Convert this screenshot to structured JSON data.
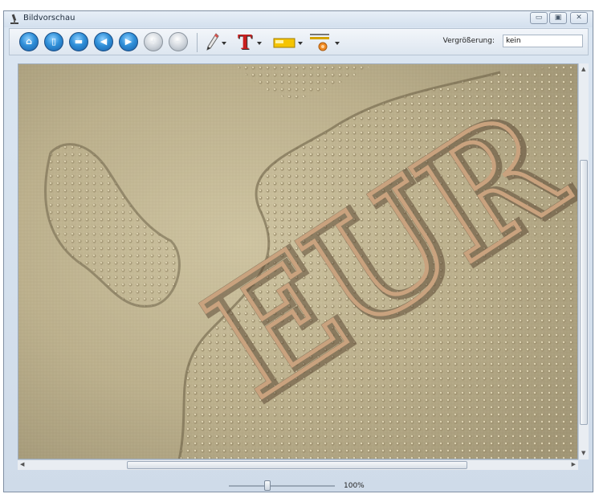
{
  "window": {
    "title": "Bildvorschau",
    "controls": {
      "minimize_glyph": "▭",
      "maximize_glyph": "▣",
      "close_glyph": "✕"
    }
  },
  "toolbar": {
    "buttons": [
      {
        "name": "home",
        "icon": "home-icon",
        "glyph": "⌂"
      },
      {
        "name": "new-document",
        "icon": "document-icon",
        "glyph": "▯"
      },
      {
        "name": "print",
        "icon": "printer-icon",
        "glyph": "▬"
      },
      {
        "name": "previous",
        "icon": "arrow-left-icon",
        "glyph": "◀"
      },
      {
        "name": "next",
        "icon": "arrow-right-icon",
        "glyph": "▶"
      },
      {
        "name": "zoom-in",
        "icon": "zoom-in-icon",
        "glyph": "+"
      },
      {
        "name": "zoom-out",
        "icon": "zoom-out-icon",
        "glyph": "−"
      }
    ],
    "tools": [
      {
        "name": "pencil",
        "icon": "pencil-icon"
      },
      {
        "name": "text",
        "icon": "text-tool-icon",
        "glyph": "T"
      },
      {
        "name": "highlight-color",
        "icon": "color-swatch-icon"
      },
      {
        "name": "line-width",
        "icon": "line-width-icon"
      }
    ],
    "zoom_label": "Vergrößerung:",
    "zoom_value": "kein"
  },
  "image": {
    "subject": "coin-closeup",
    "lettering": "EUR"
  },
  "status": {
    "zoom_percent": "100%",
    "zoom_slider_level": 0.33
  },
  "colors": {
    "accent": "#2f8fd8",
    "text_tool_red": "#c81e1e",
    "swatch_yellow": "#f5c400"
  }
}
